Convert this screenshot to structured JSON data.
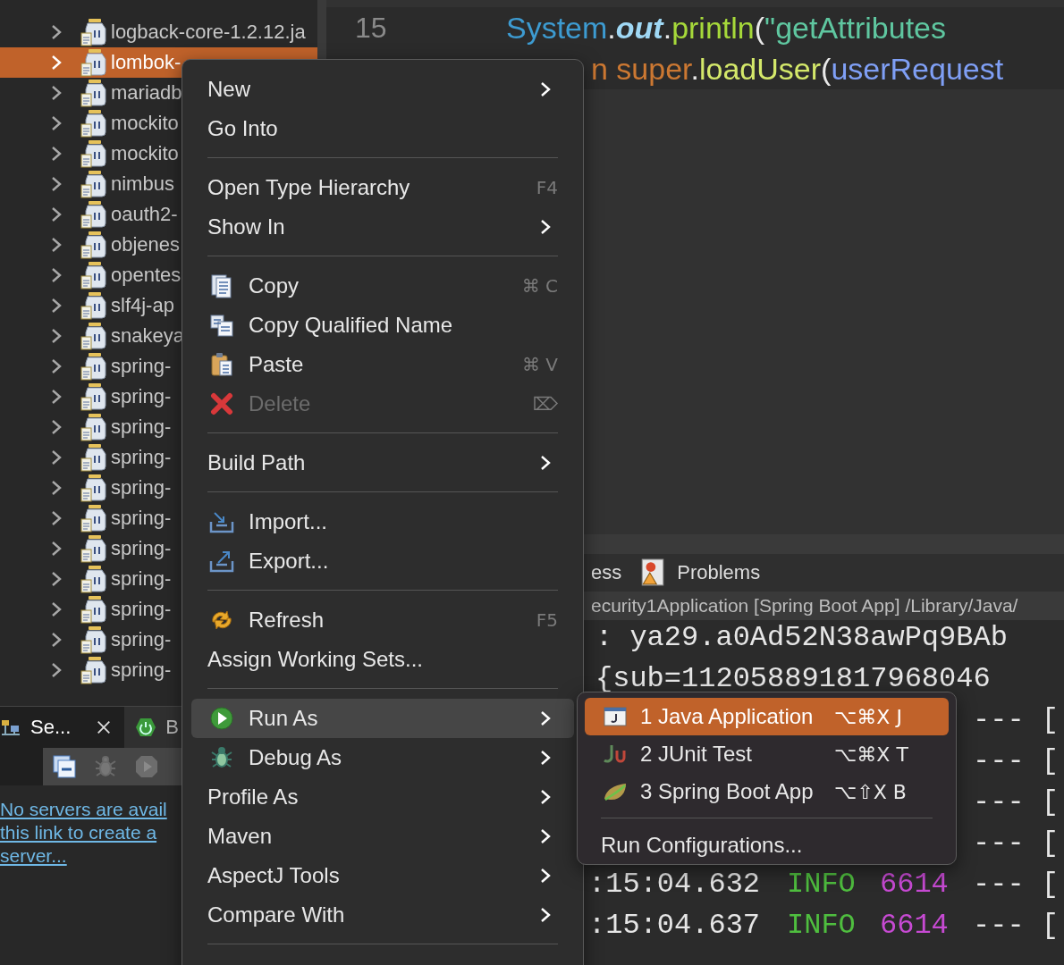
{
  "tree": {
    "items": [
      {
        "label": "logback-core-1.2.12.ja",
        "selected": false
      },
      {
        "label": "lombok-",
        "selected": true
      },
      {
        "label": "mariadb",
        "selected": false
      },
      {
        "label": "mockito",
        "selected": false
      },
      {
        "label": "mockito",
        "selected": false
      },
      {
        "label": "nimbus",
        "selected": false
      },
      {
        "label": "oauth2-",
        "selected": false
      },
      {
        "label": "objenes",
        "selected": false
      },
      {
        "label": "opentes",
        "selected": false
      },
      {
        "label": "slf4j-ap",
        "selected": false
      },
      {
        "label": "snakeya",
        "selected": false
      },
      {
        "label": "spring-",
        "selected": false
      },
      {
        "label": "spring-",
        "selected": false
      },
      {
        "label": "spring-",
        "selected": false
      },
      {
        "label": "spring-",
        "selected": false
      },
      {
        "label": "spring-",
        "selected": false
      },
      {
        "label": "spring-",
        "selected": false
      },
      {
        "label": "spring-",
        "selected": false
      },
      {
        "label": "spring-",
        "selected": false
      },
      {
        "label": "spring-",
        "selected": false
      },
      {
        "label": "spring-",
        "selected": false
      },
      {
        "label": "spring-",
        "selected": false
      }
    ]
  },
  "servers_view": {
    "tabs": [
      {
        "label": "Se...",
        "selected": true
      },
      {
        "label": "B",
        "selected": false
      }
    ],
    "toolbar": [
      {
        "disabled": false
      },
      {
        "disabled": true
      },
      {
        "disabled": true
      }
    ],
    "link_lines": [
      "No servers are avail",
      "this link to create a",
      "server..."
    ]
  },
  "editor": {
    "line_number": "15",
    "lines": [
      {
        "segments": [
          {
            "kind": "type",
            "text": "System"
          },
          {
            "kind": "punct",
            "text": "."
          },
          {
            "kind": "field",
            "text": "out"
          },
          {
            "kind": "punct",
            "text": "."
          },
          {
            "kind": "method",
            "text": "println"
          },
          {
            "kind": "punct",
            "text": "("
          },
          {
            "kind": "string",
            "text": "\"getAttributes"
          }
        ]
      },
      {
        "segments": [
          {
            "kind": "keyword",
            "text": "n super"
          },
          {
            "kind": "punct",
            "text": "."
          },
          {
            "kind": "call",
            "text": "loadUser"
          },
          {
            "kind": "punct",
            "text": "("
          },
          {
            "kind": "var",
            "text": "userRequest"
          }
        ]
      }
    ]
  },
  "console": {
    "tabs": [
      {
        "label": "ess",
        "selected": false
      },
      {
        "label": "Problems",
        "selected": false
      }
    ],
    "header": "ecurity1Application [Spring Boot App] /Library/Java/",
    "lines": [
      {
        "text": ": ya29.a0Ad52N38awPq9BAb"
      },
      {
        "text": "{sub=112058891817968046"
      },
      {
        "tail": "--- ["
      },
      {
        "tail": "--- ["
      },
      {
        "tail": "--- ["
      },
      {
        "tail": "--- ["
      },
      {
        "time": ":15:04.632",
        "level": "INFO",
        "pid": "6614",
        "tail": "--- ["
      },
      {
        "time": ":15:04.637",
        "level": "INFO",
        "pid": "6614",
        "tail": "--- ["
      }
    ]
  },
  "context_menu": {
    "items": [
      {
        "kind": "item",
        "label": "New",
        "arrow": true,
        "selected": false,
        "disabled": false
      },
      {
        "kind": "item",
        "label": "Go Into",
        "arrow": false,
        "selected": false,
        "disabled": false
      },
      {
        "kind": "separator"
      },
      {
        "kind": "item",
        "label": "Open Type Hierarchy",
        "shortcut": "F4",
        "arrow": false,
        "selected": false,
        "disabled": false
      },
      {
        "kind": "item",
        "label": "Show In",
        "arrow": true,
        "selected": false,
        "disabled": false
      },
      {
        "kind": "separator"
      },
      {
        "kind": "item",
        "label": "Copy",
        "shortcut": "⌘ C",
        "arrow": false,
        "selected": false,
        "disabled": false
      },
      {
        "kind": "item",
        "label": "Copy Qualified Name",
        "arrow": false,
        "selected": false,
        "disabled": false
      },
      {
        "kind": "item",
        "label": "Paste",
        "shortcut": "⌘ V",
        "arrow": false,
        "selected": false,
        "disabled": false
      },
      {
        "kind": "item",
        "label": "Delete",
        "shortcut": "⌦",
        "arrow": false,
        "selected": false,
        "disabled": true
      },
      {
        "kind": "separator"
      },
      {
        "kind": "item",
        "label": "Build Path",
        "arrow": true,
        "selected": false,
        "disabled": false
      },
      {
        "kind": "separator"
      },
      {
        "kind": "item",
        "label": "Import...",
        "arrow": false,
        "selected": false,
        "disabled": false
      },
      {
        "kind": "item",
        "label": "Export...",
        "arrow": false,
        "selected": false,
        "disabled": false
      },
      {
        "kind": "separator"
      },
      {
        "kind": "item",
        "label": "Refresh",
        "shortcut": "F5",
        "arrow": false,
        "selected": false,
        "disabled": false
      },
      {
        "kind": "item",
        "label": "Assign Working Sets...",
        "arrow": false,
        "selected": false,
        "disabled": false
      },
      {
        "kind": "separator"
      },
      {
        "kind": "item",
        "label": "Run As",
        "arrow": true,
        "selected": true,
        "disabled": false
      },
      {
        "kind": "item",
        "label": "Debug As",
        "arrow": true,
        "selected": false,
        "disabled": false
      },
      {
        "kind": "item",
        "label": "Profile As",
        "arrow": true,
        "selected": false,
        "disabled": false
      },
      {
        "kind": "item",
        "label": "Maven",
        "arrow": true,
        "selected": false,
        "disabled": false
      },
      {
        "kind": "item",
        "label": "AspectJ Tools",
        "arrow": true,
        "selected": false,
        "disabled": false
      },
      {
        "kind": "item",
        "label": "Compare With",
        "arrow": true,
        "selected": false,
        "disabled": false
      },
      {
        "kind": "separator"
      }
    ]
  },
  "submenu": {
    "items": [
      {
        "kind": "item",
        "label": "1 Java Application",
        "shortcut": "⌥⌘X J",
        "selected": true
      },
      {
        "kind": "item",
        "label": "2 JUnit Test",
        "shortcut": "⌥⌘X T",
        "selected": false
      },
      {
        "kind": "item",
        "label": "3 Spring Boot App",
        "shortcut": "⌥⇧X B",
        "selected": false
      },
      {
        "kind": "separator"
      },
      {
        "kind": "item",
        "label": "Run Configurations...",
        "selected": false
      }
    ]
  }
}
